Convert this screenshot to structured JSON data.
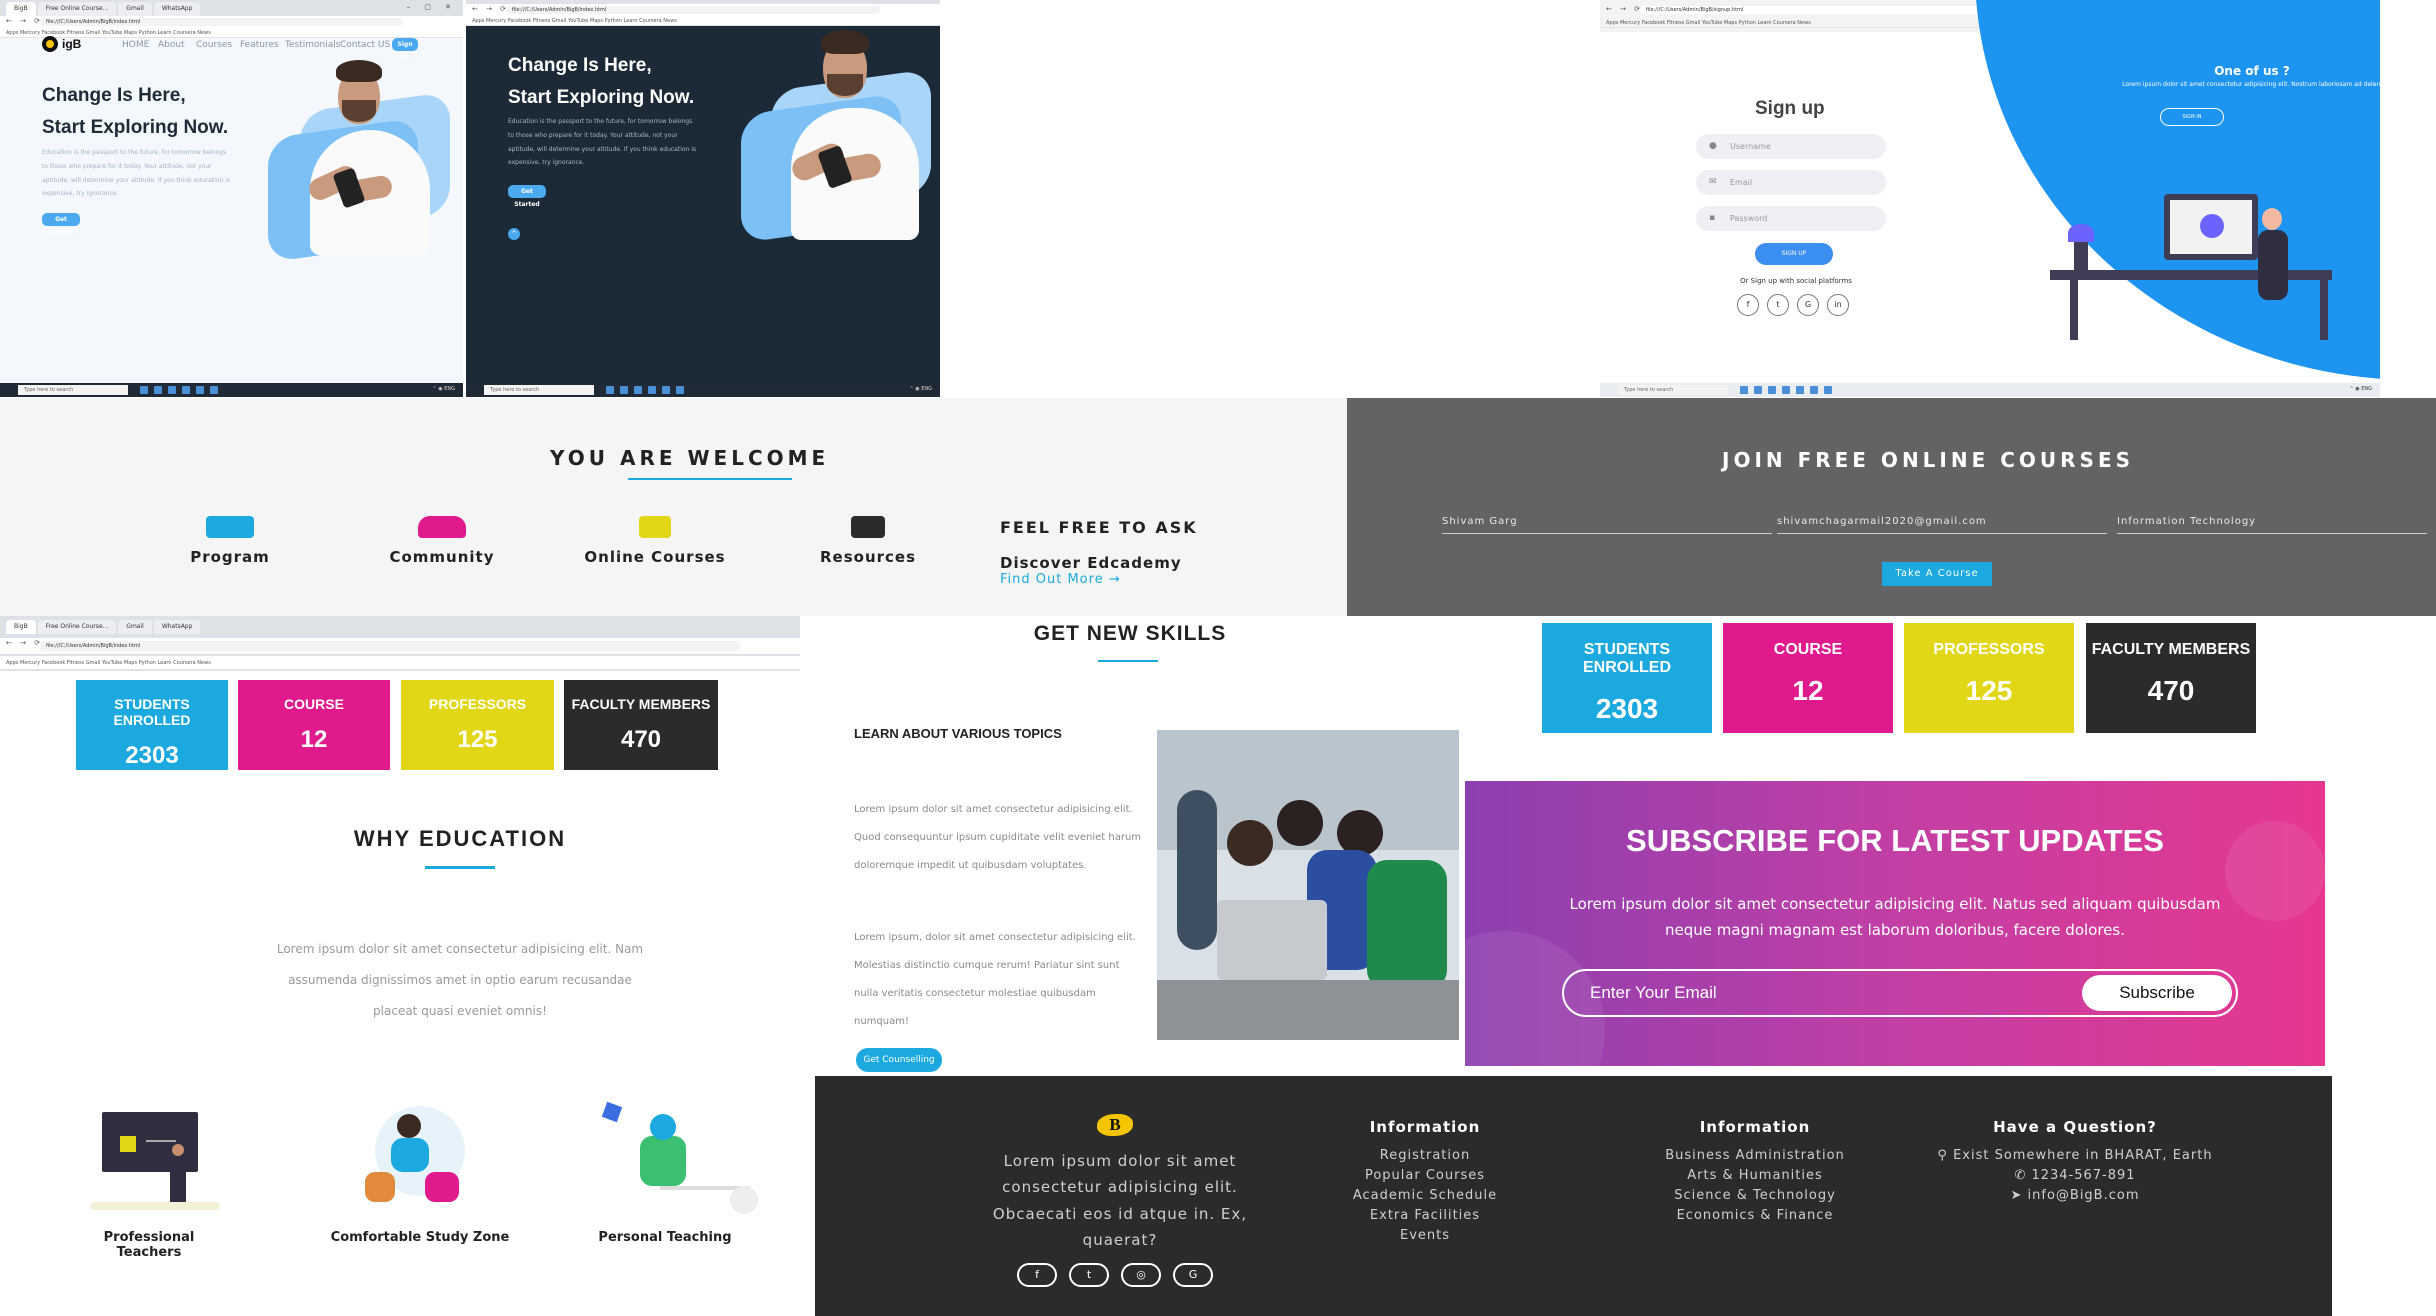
{
  "hero_light": {
    "tabs": [
      "BigB",
      "Free Online Course...",
      "Gmail",
      "WhatsApp"
    ],
    "url": "file:///C:/Users/Admin/BigB/index.html",
    "bookmarks": "Apps   Mercury  Facebook  Fitness  Gmail  YouTube  Maps  Python  Learn  Coursera  News",
    "brand": "igB",
    "nav": [
      "HOME",
      "About",
      "Courses",
      "Features",
      "Testimonials",
      "Contact US"
    ],
    "signup_button": "Sign Up",
    "title_line1": "Change Is Here,",
    "title_line2": "Start Exploring Now.",
    "body": "Education is the passport to the future, for tomorrow belongs to those who prepare for it today. Your attitude, not your aptitude, will determine your altitude. If you think education is expensive, try ignorance.",
    "cta": "Get Started",
    "taskbar_search": "Type here to search"
  },
  "hero_dark": {
    "url": "file:///C:/Users/Admin/BigB/index.html",
    "bookmarks": "Apps   Mercury  Facebook  Fitness  Gmail  YouTube  Maps  Python  Learn  Coursera  News",
    "title_line1": "Change Is Here,",
    "title_line2": "Start Exploring Now.",
    "body": "Education is the passport to the future, for tomorrow belongs to those who prepare for it today. Your attitude, not your aptitude, will determine your altitude. If you think education is expensive, try ignorance.",
    "cta": "Get Started",
    "taskbar_search": "Type here to search"
  },
  "signup": {
    "url": "file:///C:/Users/Admin/BigB/signup.html",
    "bookmarks": "Apps   Mercury  Facebook  Fitness  Gmail  YouTube  Maps  Python  Learn  Coursera  News",
    "title": "Sign up",
    "username_placeholder": "Username",
    "email_placeholder": "Email",
    "password_placeholder": "Password",
    "submit": "SIGN UP",
    "social_text": "Or Sign up with social platforms",
    "one_of_us_title": "One of us ?",
    "one_of_us_body": "Lorem ipsum dolor sit amet consectetur adipisicing elit. Nostrum laboriosam ad deleniti.",
    "signin_button": "SIGN IN",
    "taskbar_search": "Type here to search"
  },
  "welcome": {
    "title": "YOU ARE WELCOME",
    "features": [
      "Program",
      "Community",
      "Online Courses",
      "Resources"
    ],
    "feel_free": "FEEL FREE TO ASK",
    "discover": "Discover Edcademy",
    "find_out": "Find Out More →"
  },
  "join": {
    "title": "JOIN FREE ONLINE COURSES",
    "name_value": "Shivam Garg",
    "email_value": "shivamchagarmail2020@gmail.com",
    "course_value": "Information Technology",
    "button": "Take A Course"
  },
  "stats_left": {
    "tabs": [
      "BigB",
      "Free Online Course...",
      "Gmail",
      "WhatsApp"
    ],
    "url": "file:///C:/Users/Admin/BigB/index.html",
    "bookmarks": "Apps   Mercury  Facebook  Fitness  Gmail  YouTube  Maps  Python  Learn  Coursera  News",
    "items": [
      {
        "label": "STUDENTS ENROLLED",
        "value": "2303"
      },
      {
        "label": "COURSE",
        "value": "12"
      },
      {
        "label": "PROFESSORS",
        "value": "125"
      },
      {
        "label": "FACULTY MEMBERS",
        "value": "470"
      }
    ]
  },
  "stats_right": {
    "items": [
      {
        "label": "STUDENTS ENROLLED",
        "value": "2303"
      },
      {
        "label": "COURSE",
        "value": "12"
      },
      {
        "label": "PROFESSORS",
        "value": "125"
      },
      {
        "label": "FACULTY MEMBERS",
        "value": "470"
      }
    ]
  },
  "stat_colors": [
    "#1ba9e0",
    "#e0198d",
    "#e2d717",
    "#2b2b2b"
  ],
  "why": {
    "title": "WHY EDUCATION",
    "body": "Lorem ipsum dolor sit amet consectetur adipisicing elit. Nam assumenda dignissimos amet in optio earum recusandae placeat quasi eveniet omnis!",
    "items": [
      "Professional Teachers",
      "Comfortable Study Zone",
      "Personal Teaching"
    ]
  },
  "skills": {
    "title": "GET NEW SKILLS",
    "subtitle": "LEARN ABOUT VARIOUS TOPICS",
    "para1": "Lorem ipsum dolor sit amet consectetur adipisicing elit. Quod consequuntur ipsum cupiditate velit eveniet harum doloremque impedit ut quibusdam voluptates.",
    "para2": "Lorem ipsum, dolor sit amet consectetur adipisicing elit. Molestias distinctio cumque rerum! Pariatur sint sunt nulla veritatis consectetur molestiae quibusdam numquam!",
    "button": "Get Counselling"
  },
  "subscribe": {
    "title": "SUBSCRIBE FOR LATEST UPDATES",
    "body": "Lorem ipsum dolor sit amet consectetur adipisicing elit. Natus sed aliquam quibusdam neque magni magnam est laborum doloribus, facere dolores.",
    "placeholder": "Enter Your Email",
    "button": "Subscribe"
  },
  "footer": {
    "about": "Lorem ipsum dolor sit amet consectetur adipisicing elit. Obcaecati eos id atque in. Ex, quaerat?",
    "col1_title": "Information",
    "col1_links": [
      "Registration",
      "Popular Courses",
      "Academic Schedule",
      "Extra Facilities",
      "Events"
    ],
    "col2_title": "Information",
    "col2_links": [
      "Business Administration",
      "Arts & Humanities",
      "Science & Technology",
      "Economics & Finance"
    ],
    "col3_title": "Have a Question?",
    "address": "Exist Somewhere in BHARAT, Earth",
    "phone": "1234-567-891",
    "email": "info@BigB.com",
    "social": [
      "f",
      "t",
      "ig",
      "G"
    ]
  }
}
